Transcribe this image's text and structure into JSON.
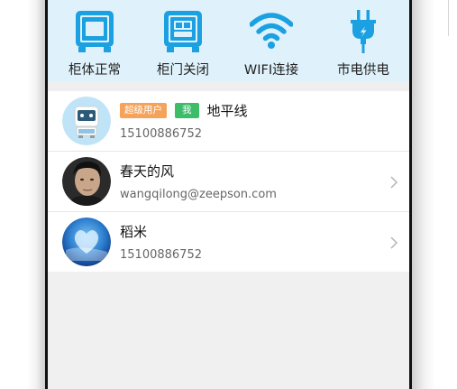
{
  "status_bar": {
    "items": [
      {
        "label": "柜体正常",
        "icon": "cabinet-icon"
      },
      {
        "label": "柜门关闭",
        "icon": "safe-door-icon"
      },
      {
        "label": "WIFI连接",
        "icon": "wifi-icon"
      },
      {
        "label": "市电供电",
        "icon": "power-plug-icon"
      }
    ],
    "accent_color": "#1ba1e2",
    "background_color": "#dff2fb"
  },
  "users": [
    {
      "badges": [
        "超级用户",
        "我"
      ],
      "name": "地平线",
      "subtitle": "15100886752",
      "avatar": "robot-avatar",
      "has_chevron": false
    },
    {
      "badges": [],
      "name": "春天的风",
      "subtitle": "wangqilong@zeepson.com",
      "avatar": "person-photo-avatar",
      "has_chevron": true
    },
    {
      "badges": [],
      "name": "稻米",
      "subtitle": "15100886752",
      "avatar": "sky-heart-avatar",
      "has_chevron": true
    }
  ],
  "colors": {
    "badge_super": "#f5a35a",
    "badge_me": "#3dbd6a"
  }
}
